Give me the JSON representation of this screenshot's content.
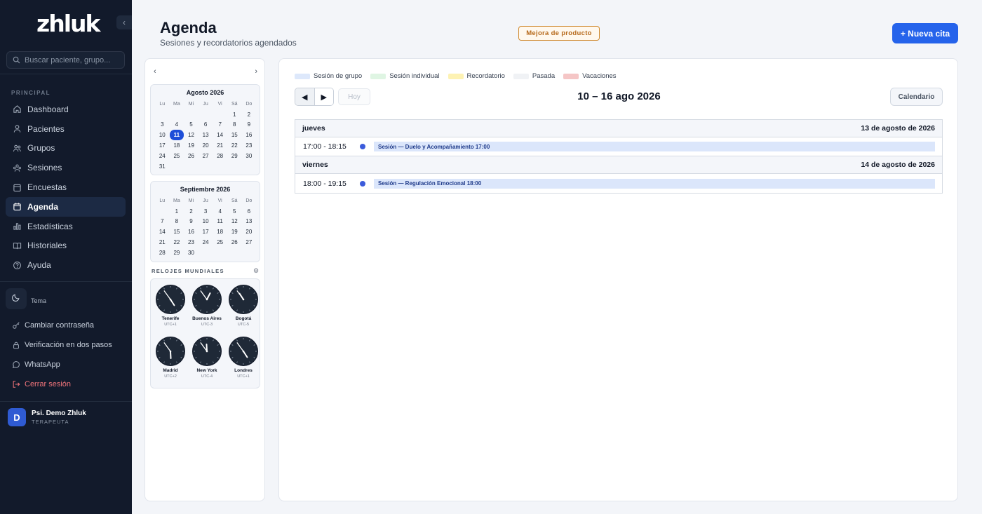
{
  "app": {
    "logo": "zhluk",
    "collapse_icon": "‹"
  },
  "search": {
    "placeholder": "Buscar paciente, grupo..."
  },
  "sidebar": {
    "section": "PRINCIPAL",
    "items": [
      {
        "label": "Dashboard"
      },
      {
        "label": "Pacientes"
      },
      {
        "label": "Grupos"
      },
      {
        "label": "Sesiones"
      },
      {
        "label": "Encuestas"
      },
      {
        "label": "Agenda",
        "active": true
      },
      {
        "label": "Estadísticas"
      },
      {
        "label": "Historiales"
      },
      {
        "label": "Ayuda"
      }
    ],
    "theme_label": "Tema",
    "links": [
      {
        "label": "Cambiar contraseña"
      },
      {
        "label": "Verificación en dos pasos"
      },
      {
        "label": "WhatsApp"
      },
      {
        "label": "Cerrar sesión"
      }
    ],
    "user": {
      "initial": "D",
      "name": "Psi. Demo Zhluk",
      "role": "TERAPEUTA"
    }
  },
  "header": {
    "title": "Agenda",
    "subtitle": "Sesiones y recordatorios agendados",
    "feedback": "Mejora de producto",
    "new_button": "+ Nueva cita"
  },
  "mini": {
    "prev": "‹",
    "next": "›",
    "day_headers": [
      "Lu",
      "Ma",
      "Mi",
      "Ju",
      "Vi",
      "Sá",
      "Do"
    ],
    "months": [
      {
        "title": "Agosto 2026",
        "offset": 5,
        "days": 31,
        "today": 11
      },
      {
        "title": "Septiembre 2026",
        "offset": 1,
        "days": 30,
        "today": null
      }
    ]
  },
  "clocks": {
    "title": "RELOJES MUNDIALES",
    "gear": "⚙",
    "items": [
      {
        "city": "Tenerife",
        "utc": "UTC+1",
        "hour": 16,
        "minute": 54
      },
      {
        "city": "Buenos Aires",
        "utc": "UTC-3",
        "hour": 12,
        "minute": 54
      },
      {
        "city": "Bogotá",
        "utc": "UTC-5",
        "hour": 10,
        "minute": 54
      },
      {
        "city": "Madrid",
        "utc": "UTC+2",
        "hour": 17,
        "minute": 54
      },
      {
        "city": "New York",
        "utc": "UTC-4",
        "hour": 11,
        "minute": 54
      },
      {
        "city": "Londres",
        "utc": "UTC+1",
        "hour": 16,
        "minute": 54
      }
    ]
  },
  "legend": [
    {
      "label": "Sesión de grupo",
      "color": "#dde8fb"
    },
    {
      "label": "Sesión individual",
      "color": "#dff5e3"
    },
    {
      "label": "Recordatorio",
      "color": "#fdf2b3"
    },
    {
      "label": "Pasada",
      "color": "#f0f2f5"
    },
    {
      "label": "Vacaciones",
      "color": "#f5c6c6"
    }
  ],
  "toolbar": {
    "prev": "◀",
    "next": "▶",
    "today": "Hoy",
    "range": "10 – 16 ago 2026",
    "view": "Calendario"
  },
  "agenda": [
    {
      "day": "jueves",
      "date": "13 de agosto de 2026",
      "time": "17:00 - 18:15",
      "event": "Sesión — Duelo y Acompañamiento 17:00"
    },
    {
      "day": "viernes",
      "date": "14 de agosto de 2026",
      "time": "18:00 - 19:15",
      "event": "Sesión — Regulación Emocional 18:00"
    }
  ]
}
